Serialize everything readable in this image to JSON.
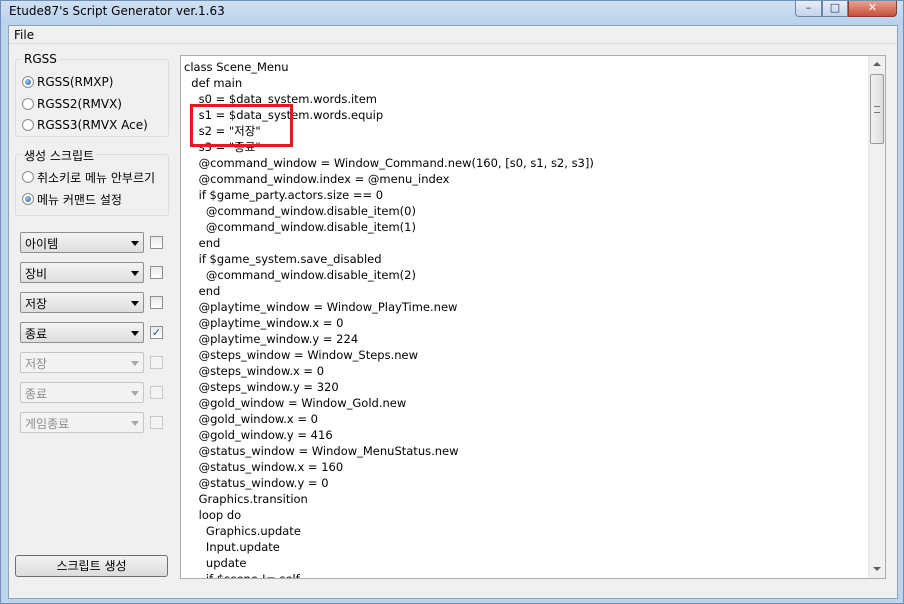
{
  "window": {
    "title": "Etude87's Script Generator ver.1.63",
    "controls": {
      "minimize": "–",
      "maximize": "□",
      "close": "✕"
    }
  },
  "menu": {
    "file": "File"
  },
  "rgss_group": {
    "label": "RGSS",
    "options": [
      "RGSS(RMXP)",
      "RGSS2(RMVX)",
      "RGSS3(RMVX Ace)"
    ],
    "selected_index": 0
  },
  "script_group": {
    "label": "생성 스크립트",
    "options": [
      "취소키로 메뉴 안부르기",
      "메뉴 커맨드 설정"
    ],
    "selected_index": 1
  },
  "commands": [
    {
      "value": "아이템",
      "enabled": true,
      "checked": false
    },
    {
      "value": "장비",
      "enabled": true,
      "checked": false
    },
    {
      "value": "저장",
      "enabled": true,
      "checked": false
    },
    {
      "value": "종료",
      "enabled": true,
      "checked": true
    },
    {
      "value": "저장",
      "enabled": false,
      "checked": false
    },
    {
      "value": "종료",
      "enabled": false,
      "checked": false
    },
    {
      "value": "게임종료",
      "enabled": false,
      "checked": false
    }
  ],
  "generate_button": "스크립트 생성",
  "checkmark": "✓",
  "code_lines": [
    "class Scene_Menu",
    "  def main",
    "    s0 = $data_system.words.item",
    "    s1 = $data_system.words.equip",
    "    s2 = \"저장\"",
    "    s3 = \"종료\"",
    "    @command_window = Window_Command.new(160, [s0, s1, s2, s3])",
    "    @command_window.index = @menu_index",
    "    if $game_party.actors.size == 0",
    "      @command_window.disable_item(0)",
    "      @command_window.disable_item(1)",
    "    end",
    "    if $game_system.save_disabled",
    "      @command_window.disable_item(2)",
    "    end",
    "    @playtime_window = Window_PlayTime.new",
    "    @playtime_window.x = 0",
    "    @playtime_window.y = 224",
    "    @steps_window = Window_Steps.new",
    "    @steps_window.x = 0",
    "    @steps_window.y = 320",
    "    @gold_window = Window_Gold.new",
    "    @gold_window.x = 0",
    "    @gold_window.y = 416",
    "    @status_window = Window_MenuStatus.new",
    "    @status_window.x = 160",
    "    @status_window.y = 0",
    "    Graphics.transition",
    "    loop do",
    "      Graphics.update",
    "      Input.update",
    "      update",
    "      if $scene != self"
  ],
  "highlight_color": "#e11b22"
}
